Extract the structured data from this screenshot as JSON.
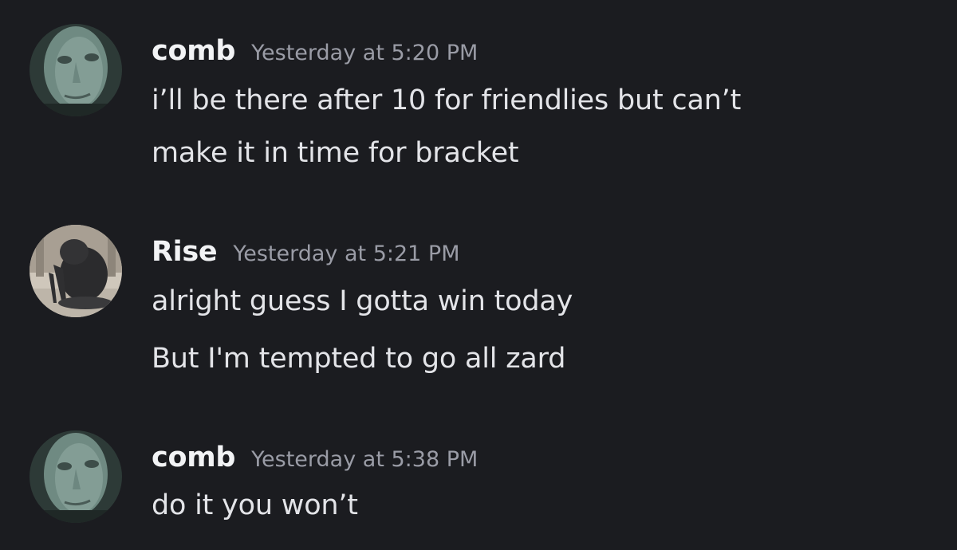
{
  "messages": [
    {
      "author": "comb",
      "timestamp": "Yesterday at 5:20 PM",
      "lines": [
        "i’ll be there after 10 for friendlies but can’t",
        "make it in time for bracket"
      ]
    },
    {
      "author": "Rise",
      "timestamp": "Yesterday at 5:21 PM",
      "lines": [
        "alright guess I gotta win today",
        "But I'm tempted to go all zard"
      ]
    },
    {
      "author": "comb",
      "timestamp": "Yesterday at 5:38 PM",
      "lines": [
        "do it you won’t"
      ]
    }
  ]
}
